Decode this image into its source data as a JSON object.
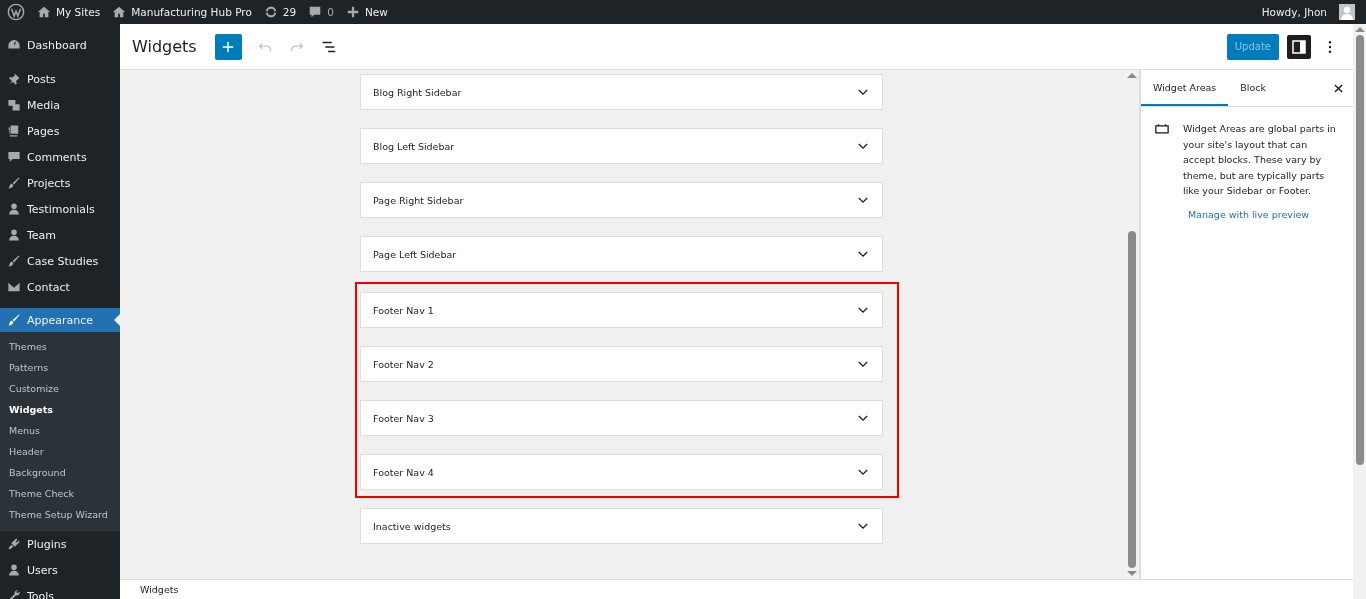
{
  "admin_bar": {
    "items": [
      {
        "kind": "logo"
      },
      {
        "kind": "sites",
        "label": "My Sites"
      },
      {
        "kind": "home",
        "label": "Manufacturing Hub Pro"
      },
      {
        "kind": "updates",
        "label": "29"
      },
      {
        "kind": "comments",
        "label": "0"
      },
      {
        "kind": "new",
        "label": "New"
      }
    ],
    "greeting": "Howdy, Jhon"
  },
  "sidebar": {
    "groups": [
      [
        {
          "kind": "dashboard",
          "label": "Dashboard",
          "selected": false
        }
      ],
      [
        {
          "kind": "pin",
          "label": "Posts",
          "selected": false
        },
        {
          "kind": "media",
          "label": "Media",
          "selected": false
        },
        {
          "kind": "pages",
          "label": "Pages",
          "selected": false
        },
        {
          "kind": "comment",
          "label": "Comments",
          "selected": false
        },
        {
          "kind": "brush",
          "label": "Projects",
          "selected": false
        },
        {
          "kind": "user",
          "label": "Testimonials",
          "selected": false
        },
        {
          "kind": "user",
          "label": "Team",
          "selected": false
        },
        {
          "kind": "brush",
          "label": "Case Studies",
          "selected": false
        },
        {
          "kind": "mail",
          "label": "Contact",
          "selected": false
        }
      ],
      [
        {
          "kind": "brush",
          "label": "Appearance",
          "selected": true,
          "children": [
            {
              "label": "Themes",
              "selected": false
            },
            {
              "label": "Patterns",
              "selected": false
            },
            {
              "label": "Customize",
              "selected": false
            },
            {
              "label": "Widgets",
              "selected": true
            },
            {
              "label": "Menus",
              "selected": false
            },
            {
              "label": "Header",
              "selected": false
            },
            {
              "label": "Background",
              "selected": false
            },
            {
              "label": "Theme Check",
              "selected": false
            },
            {
              "label": "Theme Setup Wizard",
              "selected": false
            }
          ]
        },
        {
          "kind": "plug",
          "label": "Plugins",
          "selected": false
        },
        {
          "kind": "user",
          "label": "Users",
          "selected": false
        },
        {
          "kind": "wrench",
          "label": "Tools",
          "selected": false
        }
      ]
    ]
  },
  "header": {
    "title": "Widgets",
    "update_button": "Update"
  },
  "sections": [
    {
      "kind": "plain",
      "areas": [
        "Blog Right Sidebar",
        "Blog Left Sidebar",
        "Page Right Sidebar",
        "Page Left Sidebar"
      ]
    },
    {
      "kind": "highlight",
      "areas": [
        "Footer Nav 1",
        "Footer Nav 2",
        "Footer Nav 3",
        "Footer Nav 4"
      ]
    },
    {
      "kind": "plain",
      "areas": [
        "Inactive widgets"
      ]
    }
  ],
  "panel": {
    "tabs": [
      {
        "label": "Widget Areas",
        "selected": true
      },
      {
        "label": "Block",
        "selected": false
      }
    ],
    "description": "Widget Areas are global parts in your site's layout that can accept blocks. These vary by theme, but are typically parts like your Sidebar or Footer.",
    "link": "Manage with live preview"
  },
  "footer": {
    "breadcrumb": "Widgets"
  }
}
